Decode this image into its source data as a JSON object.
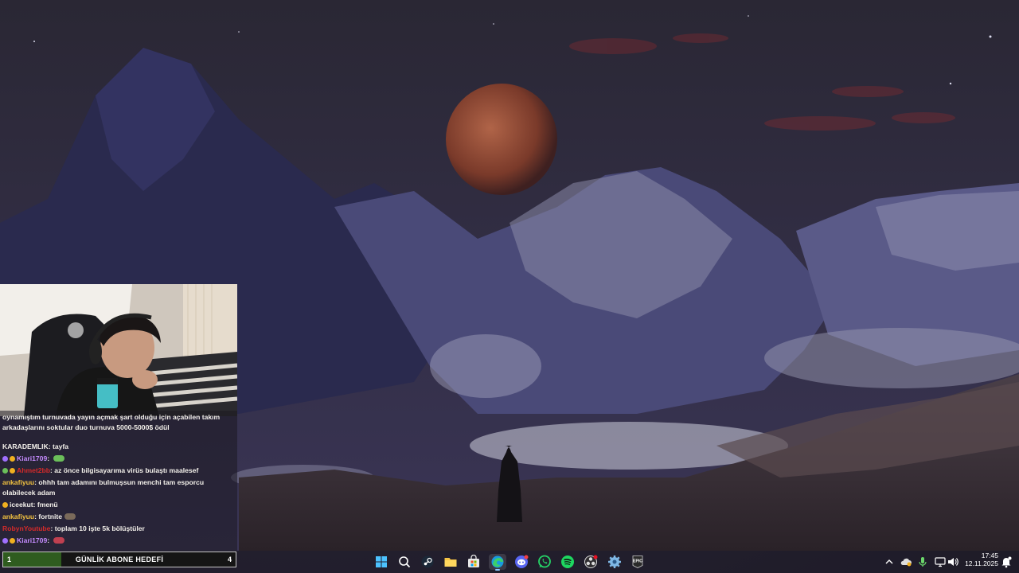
{
  "chat": {
    "messages": [
      {
        "type": "plain",
        "text": "oynamıştım turnuvada yayın açmak şart olduğu için açabilen takım arkadaşlarını soktular duo turnuva 5000-5000$ ödül"
      },
      {
        "user": "KARADEMLIK",
        "user_color": "#f3f0ea",
        "text": ": tayfa",
        "badges": []
      },
      {
        "user": "Kiari1709",
        "user_color": "#c58cff",
        "text": ": ",
        "badges": [
          "#a070ff",
          "#f0b020"
        ],
        "emote": "#6bbf5a"
      },
      {
        "user": "Ahmet2bb",
        "user_color": "#d42a2a",
        "text": ": az önce bilgisayarıma virüs bulaştı maalesef",
        "badges": [
          "#6bbf5a",
          "#f0b020"
        ]
      },
      {
        "user": "ankafiyuu",
        "user_color": "#f0c040",
        "text": ": ohhh tam adamını bulmuşsun menchi tam esporcu olabilecek adam",
        "badges": []
      },
      {
        "user": "iceekut",
        "user_color": "#f3f0ea",
        "text": ": fmenü",
        "badges": [
          "#f0b020"
        ]
      },
      {
        "user": "ankafiyuu",
        "user_color": "#f0c040",
        "text": ": fortnite",
        "badges": [],
        "emote": "#7a6a5a"
      },
      {
        "user": "RobynYoutube",
        "user_color": "#d42a2a",
        "text": ": toplam 10 işte 5k bölüştüler",
        "badges": []
      },
      {
        "user": "Kiari1709",
        "user_color": "#c58cff",
        "text": ": ",
        "badges": [
          "#a070ff",
          "#f0b020"
        ],
        "emote": "#c04050"
      }
    ]
  },
  "goal": {
    "left": "1",
    "title": "GÜNLİK ABONE HEDEFİ",
    "right": "4",
    "progress": 0.25
  },
  "taskbar": {
    "apps": [
      "start-icon",
      "search-icon",
      "steam-icon",
      "file-explorer-icon",
      "microsoft-store-icon",
      "edge-icon",
      "discord-icon",
      "whatsapp-icon",
      "spotify-icon",
      "obs-icon",
      "settings-app-icon",
      "epic-games-icon"
    ],
    "epic_label": "EPIC"
  },
  "clock": {
    "time": "17:45",
    "date": "12.11.2025"
  },
  "colors": {
    "accent": "#8cc8ff",
    "goal_fill": "#2f5c1f"
  }
}
